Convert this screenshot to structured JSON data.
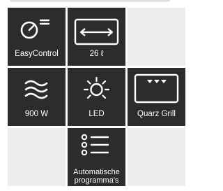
{
  "features": [
    {
      "label": "EasyControl",
      "icon": "easycontrol-knob-icon"
    },
    {
      "label": "26 ℓ",
      "icon": "capacity-arrows-icon"
    },
    {
      "label": "900 W",
      "icon": "microwave-waves-icon"
    },
    {
      "label": "LED",
      "icon": "light-bulb-icon"
    },
    {
      "label": "Quarz Grill",
      "icon": "grill-heater-icon"
    },
    {
      "label": "Automatische programma's",
      "icon": "program-list-icon"
    }
  ],
  "colors": {
    "tile": "#2c2c2c",
    "empty_tile": "#ececec",
    "foreground": "#ffffff"
  }
}
